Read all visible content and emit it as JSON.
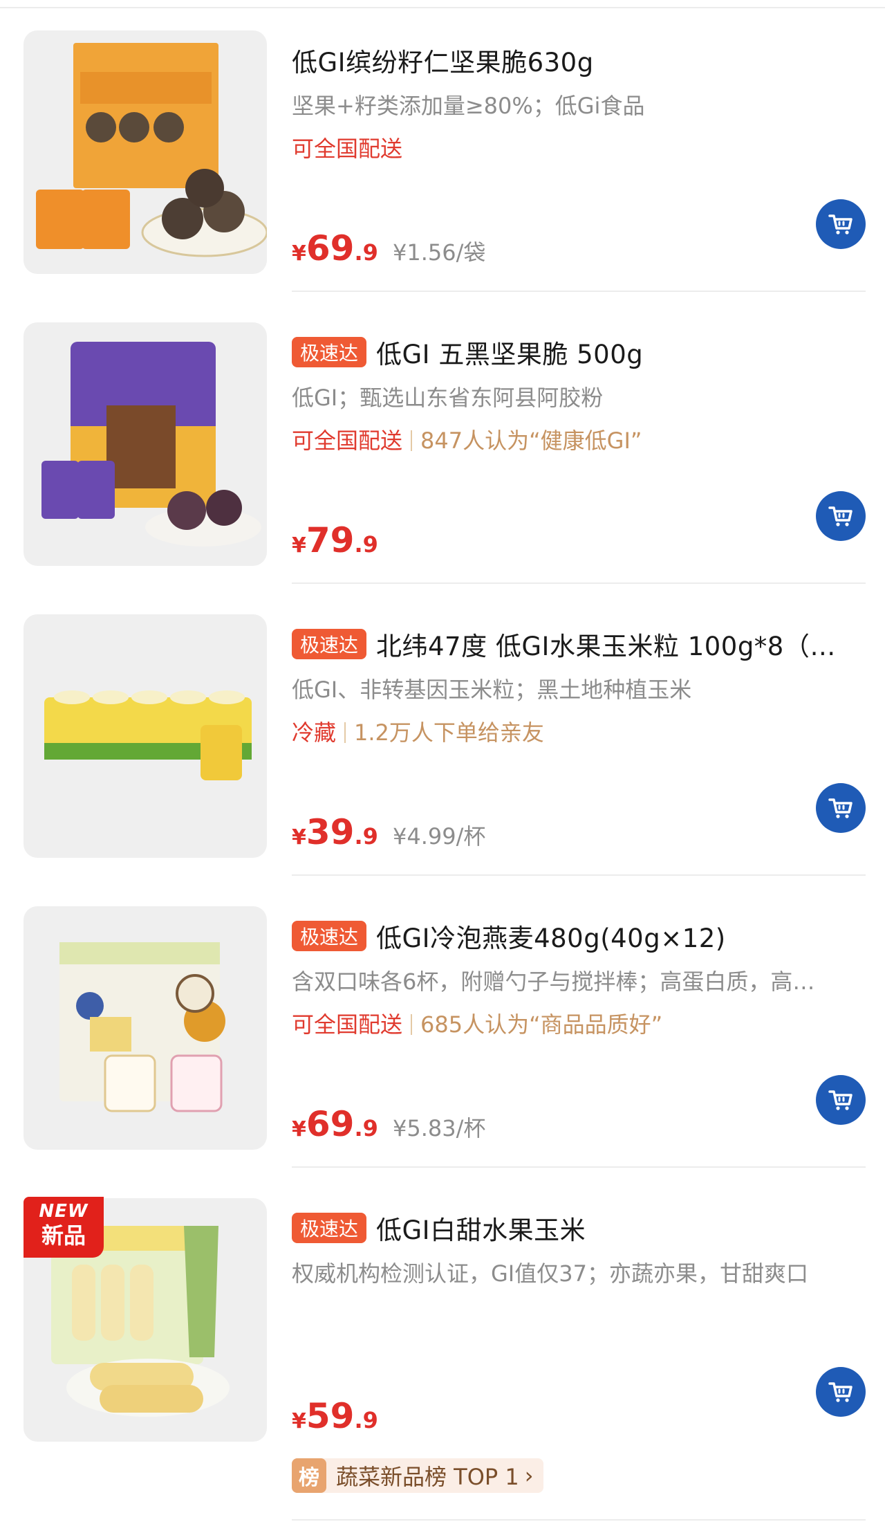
{
  "products": [
    {
      "tag": "",
      "title": "低GI缤纷籽仁坚果脆630g",
      "desc": "坚果+籽类添加量≥80%；低Gi食品",
      "delivery": "可全国配送",
      "social": "",
      "price_yen": "¥",
      "price_int": "69",
      "price_dec": ".9",
      "unit_price": "¥1.56/袋"
    },
    {
      "tag": "极速达",
      "title": "低GI 五黑坚果脆 500g",
      "desc": "低GI；甄选山东省东阿县阿胶粉",
      "delivery": "可全国配送",
      "social": "847人认为“健康低GI”",
      "price_yen": "¥",
      "price_int": "79",
      "price_dec": ".9",
      "unit_price": ""
    },
    {
      "tag": "极速达",
      "title": "北纬47度 低GI水果玉米粒 100g*8（…",
      "desc": "低GI、非转基因玉米粒；黑土地种植玉米",
      "delivery": "冷藏",
      "social": "1.2万人下单给亲友",
      "price_yen": "¥",
      "price_int": "39",
      "price_dec": ".9",
      "unit_price": "¥4.99/杯"
    },
    {
      "tag": "极速达",
      "title": "低GI冷泡燕麦480g(40g×12)",
      "desc": "含双口味各6杯，附赠勺子与搅拌棒；高蛋白质，高…",
      "delivery": "可全国配送",
      "social": "685人认为“商品品质好”",
      "price_yen": "¥",
      "price_int": "69",
      "price_dec": ".9",
      "unit_price": "¥5.83/杯"
    },
    {
      "tag": "极速达",
      "title": "低GI白甜水果玉米",
      "desc": "权威机构检测认证，GI值仅37；亦蔬亦果，甘甜爽口",
      "delivery": "",
      "social": "",
      "price_yen": "¥",
      "price_int": "59",
      "price_dec": ".9",
      "unit_price": ""
    }
  ],
  "new_badge": {
    "en": "NEW",
    "cn": "新品"
  },
  "rank": {
    "badge": "榜",
    "text": "蔬菜新品榜 TOP 1",
    "chevron": "›"
  },
  "colors": {
    "accent_red": "#e02f2a",
    "tag_orange": "#ef5a34",
    "cart_blue": "#1f5bb6",
    "social_gold": "#c69361"
  },
  "icons": {
    "cart": "shopping-cart-icon"
  }
}
